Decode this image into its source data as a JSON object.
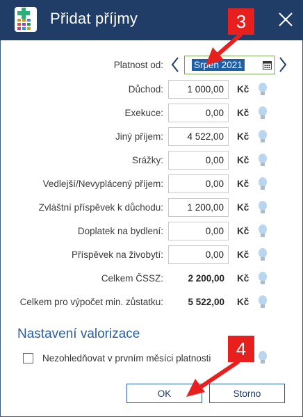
{
  "window": {
    "title": "Přidat příjmy",
    "app_icon": "calculator-plus-icon",
    "close_icon": "close-icon"
  },
  "date_row": {
    "label": "Platnost od:",
    "value": "Srpen 2021",
    "prev_icon": "chevron-left-icon",
    "next_icon": "chevron-right-icon",
    "calendar_icon": "calendar-icon"
  },
  "currency": "Kč",
  "hint_icon": "lightbulb-icon",
  "fields": [
    {
      "label": "Důchod:",
      "value": "1 000,00"
    },
    {
      "label": "Exekuce:",
      "value": "0,00"
    },
    {
      "label": "Jiný příjem:",
      "value": "4 522,00"
    },
    {
      "label": "Srážky:",
      "value": "0,00"
    },
    {
      "label": "Vedlejší/Nevyplácený příjem:",
      "value": "0,00"
    },
    {
      "label": "Zvláštní příspěvek k důchodu:",
      "value": "1 200,00"
    },
    {
      "label": "Doplatek na bydlení:",
      "value": "0,00"
    },
    {
      "label": "Příspěvek na živobytí:",
      "value": "0,00"
    }
  ],
  "totals": [
    {
      "label": "Celkem ČSSZ:",
      "value": "2 200,00"
    },
    {
      "label": "Celkem pro výpočet min. zůstatku:",
      "value": "5 522,00"
    }
  ],
  "valorization": {
    "section_title": "Nastavení valorizace",
    "checkbox_label": "Nezohledňovat v prvním měsíci platnosti",
    "checked": false
  },
  "buttons": {
    "ok": "OK",
    "cancel": "Storno"
  },
  "annotations": [
    {
      "number": "3"
    },
    {
      "number": "4"
    }
  ],
  "colors": {
    "titlebar": "#1f3d67",
    "accent": "#2a5fa0",
    "callout": "#e8201d",
    "selection": "#1f5fa8"
  }
}
